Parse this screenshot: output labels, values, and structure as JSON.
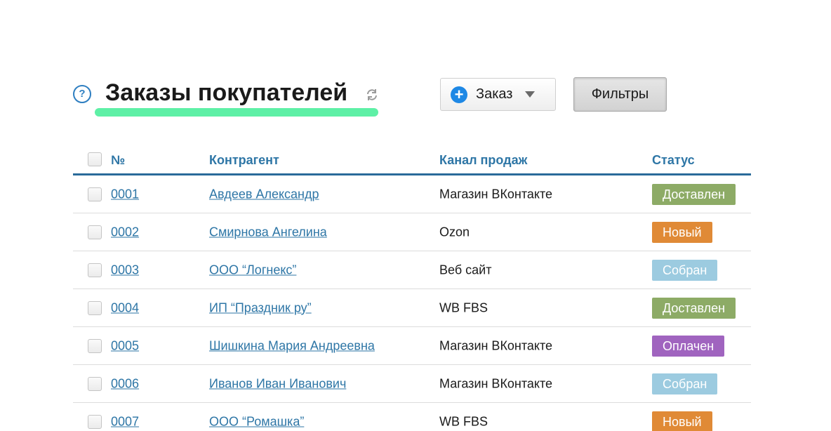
{
  "header": {
    "help_symbol": "?",
    "title": "Заказы покупателей",
    "order_button_label": "Заказ",
    "filters_button_label": "Фильтры",
    "accent_underline_color": "#5ef0a6"
  },
  "table": {
    "columns": {
      "number": "№",
      "counterparty": "Контрагент",
      "channel": "Канал продаж",
      "status": "Статус"
    },
    "rows": [
      {
        "number": "0001",
        "counterparty": "Авдеев Александр",
        "channel": "Магазин ВКонтакте",
        "status": "Доставлен",
        "status_color": "#8dab66"
      },
      {
        "number": "0002",
        "counterparty": "Смирнова Ангелина",
        "channel": "Ozon",
        "status": "Новый",
        "status_color": "#e08a36"
      },
      {
        "number": "0003",
        "counterparty": "ООО “Логнекс”",
        "channel": "Веб сайт",
        "status": "Собран",
        "status_color": "#9ccbe0"
      },
      {
        "number": "0004",
        "counterparty": "ИП “Праздник ру”",
        "channel": "WB FBS",
        "status": "Доставлен",
        "status_color": "#8dab66"
      },
      {
        "number": "0005",
        "counterparty": "Шишкина Мария Андреевна",
        "channel": "Магазин ВКонтакте",
        "status": "Оплачен",
        "status_color": "#a064bf"
      },
      {
        "number": "0006",
        "counterparty": "Иванов Иван Иванович",
        "channel": "Магазин ВКонтакте",
        "status": "Собран",
        "status_color": "#9ccbe0"
      },
      {
        "number": "0007",
        "counterparty": "ООО “Ромашка”",
        "channel": "WB FBS",
        "status": "Новый",
        "status_color": "#e08a36"
      }
    ]
  },
  "icons": {
    "help": "help-circle-icon",
    "refresh": "refresh-icon",
    "add": "plus-circle-icon",
    "dropdown": "caret-down-icon"
  }
}
